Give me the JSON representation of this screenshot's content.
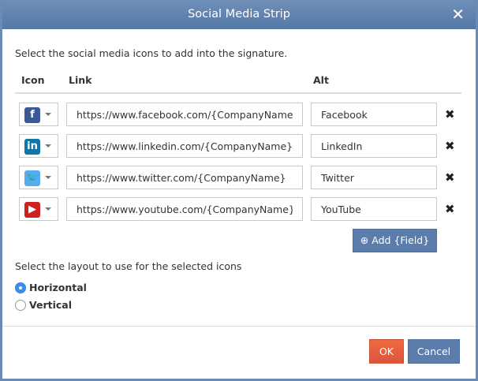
{
  "dialog": {
    "title": "Social Media Strip",
    "close_icon": "close-icon"
  },
  "intro": "Select the social media icons to add into the signature.",
  "columns": {
    "icon": "Icon",
    "link": "Link",
    "alt": "Alt"
  },
  "rows": [
    {
      "icon": "facebook-icon",
      "glyph": "f",
      "color": "#3b5998",
      "link": "https://www.facebook.com/{CompanyName}",
      "alt": "Facebook"
    },
    {
      "icon": "linkedin-icon",
      "glyph": "in",
      "color": "#0e76a8",
      "link": "https://www.linkedin.com/{CompanyName}",
      "alt": "LinkedIn"
    },
    {
      "icon": "twitter-icon",
      "glyph": "🐦",
      "color": "#55acee",
      "link": "https://www.twitter.com/{CompanyName}",
      "alt": "Twitter"
    },
    {
      "icon": "youtube-icon",
      "glyph": "▶",
      "color": "#cd201f",
      "link": "https://www.youtube.com/{CompanyName}",
      "alt": "YouTube"
    }
  ],
  "add_button": "Add {Field}",
  "layout_prompt": "Select the layout to use for the selected icons",
  "layouts": [
    {
      "label": "Horizontal",
      "selected": true
    },
    {
      "label": "Vertical",
      "selected": false
    }
  ],
  "footer": {
    "ok": "OK",
    "cancel": "Cancel"
  },
  "colors": {
    "header": "#5d80ab",
    "ok": "#e85f3c",
    "cancel": "#5679a6",
    "radio": "#3b8ef0"
  }
}
